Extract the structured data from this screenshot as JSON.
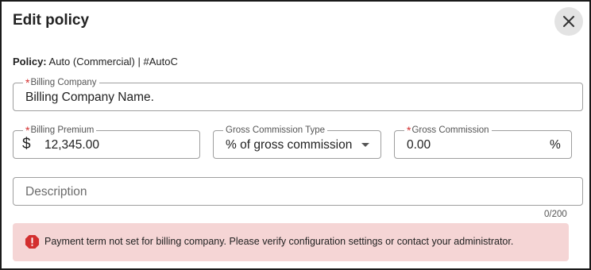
{
  "dialog": {
    "title": "Edit policy",
    "close_icon": "close-icon"
  },
  "policy": {
    "label": "Policy:",
    "value": "Auto (Commercial) | #AutoC"
  },
  "billing_company": {
    "label": "Billing Company",
    "required_mark": "*",
    "value": "Billing Company Name."
  },
  "billing_premium": {
    "label": "Billing Premium",
    "required_mark": "*",
    "currency": "$",
    "value": "12,345.00"
  },
  "gross_commission_type": {
    "label": "Gross Commission Type",
    "selected": "% of gross commission",
    "dropdown_icon": "caret-down-icon"
  },
  "gross_commission": {
    "label": "Gross Commission",
    "required_mark": "*",
    "value": "0.00",
    "suffix": "%"
  },
  "description": {
    "placeholder": "Description",
    "counter": "0/200"
  },
  "alert": {
    "icon": "error-icon",
    "color": "#d32f2f",
    "background": "#f5d5d5",
    "message": "Payment term not set for billing company. Please verify configuration settings or contact your administrator."
  }
}
